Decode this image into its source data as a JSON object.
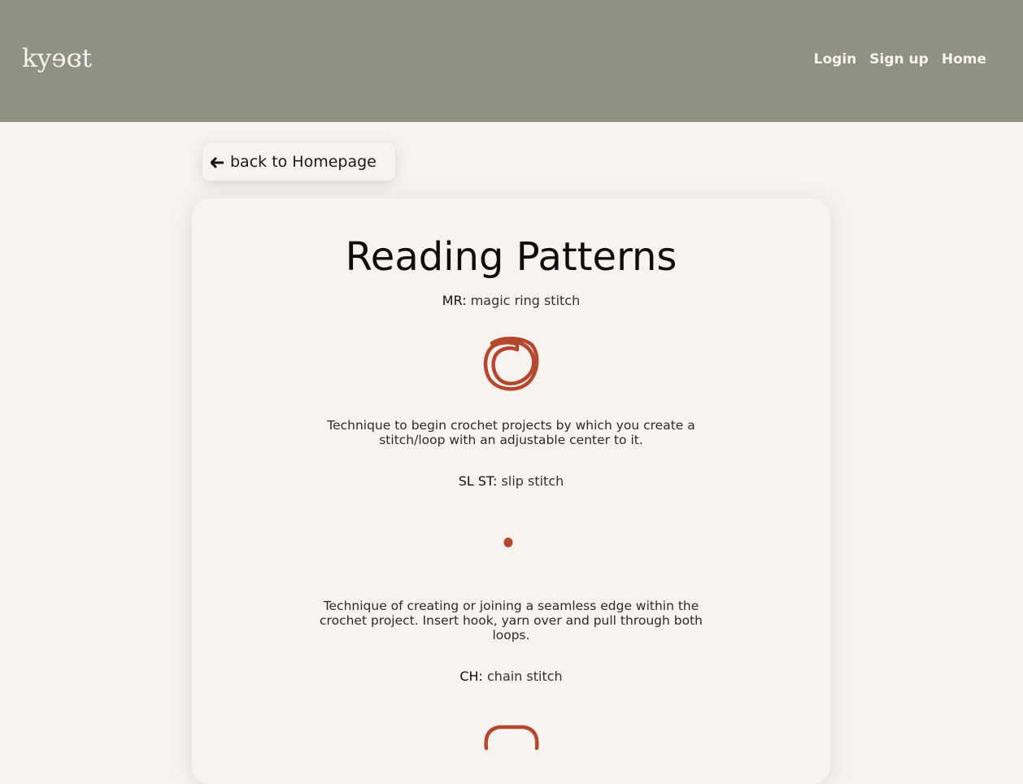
{
  "header": {
    "logo": "kyɘɞt",
    "nav": [
      {
        "label": "Login"
      },
      {
        "label": "Sign up"
      },
      {
        "label": "Home"
      }
    ]
  },
  "back_button": {
    "label": "back to Homepage",
    "icon": "arrow-left-icon"
  },
  "page": {
    "title": "Reading Patterns",
    "terms": [
      {
        "abbr": "MR:",
        "name": "magic ring stitch",
        "symbol": "magic-ring-icon",
        "description": "Technique to begin crochet projects by which you create a stitch/loop with an adjustable center to it."
      },
      {
        "abbr": "SL ST:",
        "name": "slip stitch",
        "symbol": "slip-stitch-dot-icon",
        "description": "Technique of creating or joining a seamless edge within the crochet project. Insert hook, yarn over and pull through both loops."
      },
      {
        "abbr": "CH:",
        "name": "chain stitch",
        "symbol": "chain-stitch-oval-icon",
        "description": ""
      }
    ]
  },
  "colors": {
    "header_bg": "#8f9183",
    "page_bg": "#f8f3ee",
    "symbol": "#b5472f"
  }
}
